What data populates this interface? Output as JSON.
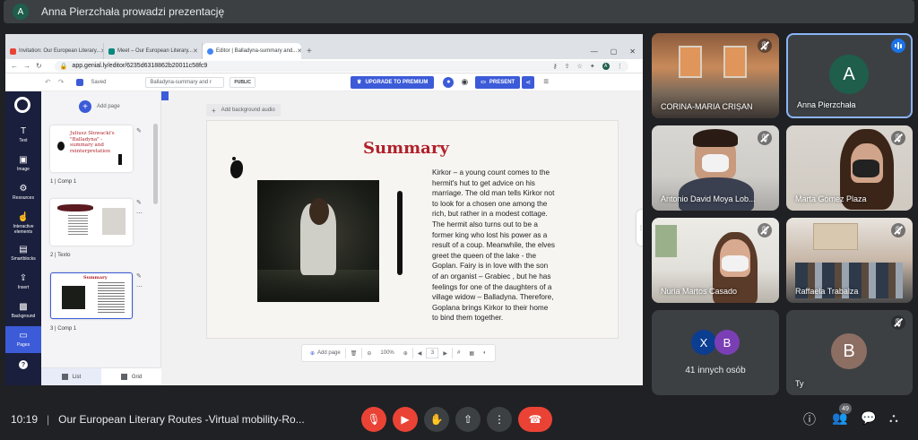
{
  "meet": {
    "presenter_initial": "A",
    "presenting_banner": "Anna Pierzchała prowadzi prezentację",
    "time": "10:19",
    "meeting_title": "Our European Literary Routes -Virtual mobility-Ro...",
    "participants_count": "49",
    "tiles": [
      {
        "name": "CORINA-MARIA CRIȘAN"
      },
      {
        "name": "Anna Pierzchała",
        "initial": "A"
      },
      {
        "name": "Antonio David Moya Lob..."
      },
      {
        "name": "Marta Gómez Plaza"
      },
      {
        "name": "Nuria Martos Casado"
      },
      {
        "name": "Raffaela Trabalza"
      },
      {
        "name": "41 innych osób",
        "initials": [
          "X",
          "B"
        ]
      },
      {
        "name": "Ty",
        "initial": "B"
      }
    ],
    "colors": {
      "hangup": "#ea4335",
      "accent": "#1a73e8",
      "bg": "#202124"
    }
  },
  "browser": {
    "tabs": [
      {
        "label": "Invitation: Our European Literary...",
        "icon": "gmail-icon"
      },
      {
        "label": "Meet – Our European Literary...",
        "icon": "meet-icon"
      },
      {
        "label": "Editor | Balladyna-summary and...",
        "icon": "chrome-icon"
      }
    ],
    "url": "app.genial.ly/editor/6235d6318862b20011c58fc9",
    "profile_initial": "A"
  },
  "genially": {
    "saved_label": "Saved",
    "doc_title": "Balladyna-summary and r",
    "public_label": "PUBLIC",
    "upgrade_label": "UPGRADE TO PREMIUM",
    "present_label": "PRESENT",
    "rail": [
      {
        "label": "Text",
        "icon": "T"
      },
      {
        "label": "Image",
        "icon": "▣"
      },
      {
        "label": "Resources",
        "icon": "⚙"
      },
      {
        "label": "Interactive elements",
        "icon": "☝"
      },
      {
        "label": "Smartblocks",
        "icon": "▤"
      },
      {
        "label": "Insert",
        "icon": "⇪"
      },
      {
        "label": "Background",
        "icon": "▩"
      },
      {
        "label": "Pages",
        "icon": "▭"
      }
    ],
    "add_page_label": "Add page",
    "pages": [
      {
        "label": "1 | Comp 1",
        "preview_title": "Juliusz Słowacki's \"Balladyna\" - summary and reinterpretation"
      },
      {
        "label": "2 | Texto"
      },
      {
        "label": "3 | Comp 1",
        "preview_title": "Summary"
      }
    ],
    "list_label": "List",
    "grid_label": "Grid",
    "add_audio_label": "Add background audio",
    "zoom": "100%",
    "add_page_small": "Add page",
    "current_page": "3",
    "slide": {
      "title": "Summary",
      "body": "Kirkor – a young count comes to the hermit's hut to get advice on his marriage. The old man tells Kirkor not to look for a chosen one among the rich, but rather in a modest cottage. The hermit also turns out to be a former king who lost his power as a result of a coup. Meanwhile, the elves greet the queen of the lake - the Goplan. Fairy is in love with the son of an organist – Grabiec , but he has feelings for one of the daughters of a village widow – Balladyna. Therefore, Goplana brings Kirkor to their home to bind them together."
    }
  }
}
